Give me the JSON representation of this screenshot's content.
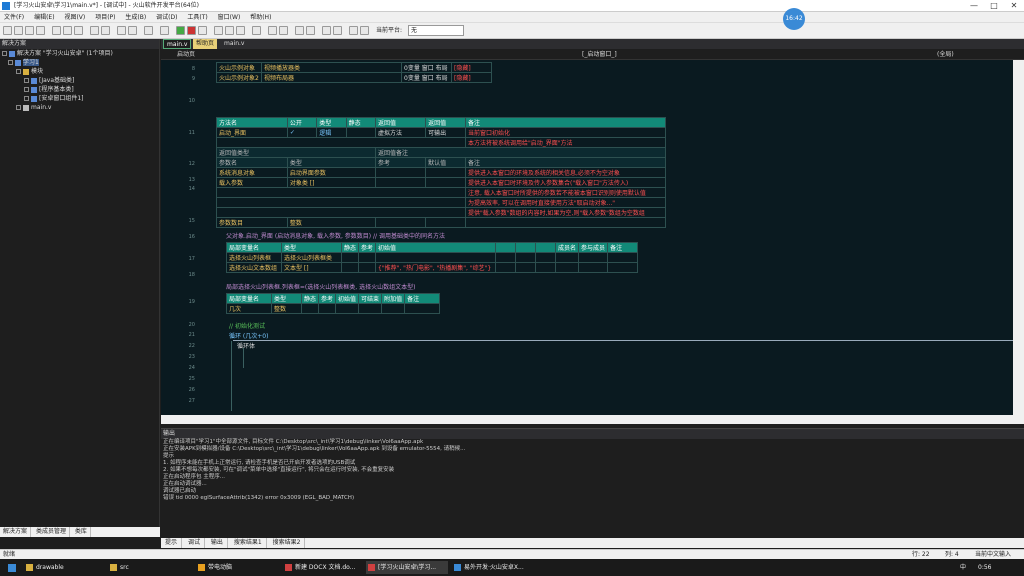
{
  "titlebar": {
    "title": "[学习火山安卓\\学习1\\main.v*] - [调试中] - 火山软件开发平台(64位)",
    "minimize": "—",
    "maximize": "□",
    "close": "✕"
  },
  "menu": [
    "文件(F)",
    "编辑(E)",
    "视图(V)",
    "项目(P)",
    "生成(B)",
    "调试(D)",
    "工具(T)",
    "窗口(W)",
    "帮助(H)"
  ],
  "toolbar": {
    "platform_label": "当前平台:",
    "platform_value": "无"
  },
  "clock_badge": "16:42",
  "left_panel": {
    "title": "解决方案",
    "tree": [
      "解决方案 \"学习火山安卓\" (1个项目)",
      "学习1",
      "模块",
      "[Java基础类]",
      "[程序基本类]",
      "[安卓窗口组件1]",
      "main.v"
    ],
    "tabs": [
      "解决方案",
      "类成员管理",
      "类库"
    ]
  },
  "editor_tabs": [
    "main.v",
    "帮助页",
    "main.v"
  ],
  "nav": {
    "left": "启动页",
    "middle": "[_启动窗口_]",
    "right": "(全局)"
  },
  "lines": {
    "l1": "8",
    "l2": "9",
    "l3": "10",
    "l4": "11",
    "l5": "12",
    "l6": "13",
    "l7": "14",
    "l8": "15",
    "l9": "16",
    "l10": "17",
    "l11": "18",
    "l12": "19",
    "l13": "20",
    "l14": "21",
    "l15": "22",
    "l16": "23",
    "l17": "24",
    "l18": "25",
    "l19": "26",
    "l20": "27"
  },
  "code": {
    "top_row1": {
      "a": "火山示例对象",
      "b": "视频播放器类",
      "c": "0变量 窗口 布局",
      "d": "[隐藏]"
    },
    "top_row2": {
      "a": "火山示例对象2",
      "b": "视频布局器",
      "c": "0变量 窗口 布局",
      "d": "[隐藏]"
    },
    "method_table": {
      "headers": [
        "方法名",
        "公开",
        "类型",
        "静态",
        "返回值",
        "返回值",
        "备注"
      ],
      "row": [
        "启动_界面",
        "✓",
        "逻辑",
        "",
        "虚拟方法",
        "可输出",
        "当前窗口初始化"
      ],
      "note2": "本方法将被系统调用给\"启动_界面\"方法",
      "sub_headers": [
        "返回值类型",
        "",
        "",
        "",
        "返回值备注"
      ],
      "params_header": [
        "参数名",
        "类型",
        "",
        "",
        "参考",
        "默认值",
        "备注"
      ],
      "p1": [
        "系统消息对象",
        "启动界面参数"
      ],
      "p1_note": "提供进入本窗口的环境及系统的相关信息,必须不为空对象",
      "p2": [
        "载入参数",
        "对象类 []"
      ],
      "p2_note": "提供进入本窗口时环境及传入参数集合(\"载入窗口\"方法传入)",
      "p2_note2": "注意, 载入本窗口时所提供的参数若不能被本窗口识别则使用默认值",
      "p2_note3": "为提高效率, 可以在调用时直接使用方法\"取启动对象...\"",
      "p2_note4": "提供\"载入参数\"数组的内容时,如果为空,则\"载入参数\"数组为空数组",
      "p3": [
        "参数数目",
        "整数"
      ]
    },
    "line15": "父对象.启动_界面 (启动消息对象, 载入参数, 参数数目)  // 调用基础类中的同名方法",
    "local_table": {
      "headers": [
        "局部变量名",
        "类型",
        "静态",
        "参考",
        "初始值",
        "",
        "",
        "",
        "成员名",
        "参与成员",
        "备注"
      ],
      "r1": [
        "选择火山列表框",
        "选择火山列表框类"
      ],
      "r2": [
        "选择火山文本数组",
        "文本型 []",
        "{\"推荐\", \"热门电影\", \"热播剧集\", \"综艺\"}"
      ]
    },
    "line19": "局部选择火山列表框.列表框=(选择火山列表框类, 选择火山数组文本型)",
    "local2": {
      "headers": [
        "局部变量名",
        "类型",
        "静态",
        "参考",
        "初始值",
        "可结束",
        "附加值",
        "备注"
      ],
      "r1": [
        "几次",
        "整数"
      ]
    },
    "comment": "// 初始化测试",
    "loop": "循环 (几次+0)",
    "inner": "循环体"
  },
  "output": {
    "title": "输出",
    "lines": [
      "正在编译项目\"学习1\"中全部源文件, 目标文件 C:\\Desktop\\src\\_int\\学习1\\debug\\linker\\Vol6aaApp.apk",
      "正在安装APK到模拟器/设备 C:\\Desktop\\src\\_int\\学习1\\debug\\linker\\Vol6aaApp.apk 到设备 emulator-5554, 请稍候...",
      "提示",
      "  1. 如程序未能在手机上正常运行, 请检查手机是否已开启开发者选项的USB调试",
      "  2. 如果不想每次都安装, 可在\"调试\"菜单中选择\"直接运行\", 将只会在运行时安装, 不会重复安装",
      "正在启动程序包 主程序...",
      "正在启动调试器...",
      "调试器已启动",
      "错误 tid 0000 eglSurfaceAttrib(1342) error 0x3009 (EGL_BAD_MATCH)"
    ],
    "tabs": [
      "提示",
      "调试",
      "输出",
      "搜索结果1",
      "搜索结果2"
    ]
  },
  "status": {
    "left": "就绪",
    "line": "行: 22",
    "col": "列: 4",
    "mode": "当前中文输入"
  },
  "taskbar": {
    "items": [
      "drawable",
      "src",
      "带电动脑",
      "新建 DOCX 文档.do...",
      "[学习火山安卓\\学习...",
      "易外开发·火山安卓X..."
    ],
    "time": "0:56",
    "lang": "中"
  },
  "colors": {
    "teal": "#128a78",
    "editor_bg": "#0a1a20",
    "accent": "#1e7bd6"
  }
}
